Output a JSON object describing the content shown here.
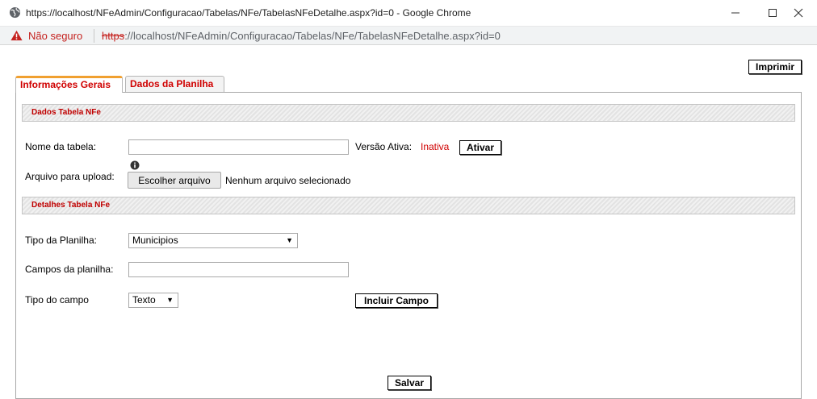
{
  "window": {
    "title": "https://localhost/NFeAdmin/Configuracao/Tabelas/NFe/TabelasNFeDetalhe.aspx?id=0 - Google Chrome",
    "icon": "globe-icon",
    "controls": [
      "minimize-icon",
      "maximize-icon",
      "close-icon"
    ]
  },
  "address_bar": {
    "security_label": "Não seguro",
    "url_scheme": "https",
    "url_rest": "://localhost/NFeAdmin/Configuracao/Tabelas/NFe/TabelasNFeDetalhe.aspx?id=0"
  },
  "toolbar": {
    "print_label": "Imprimir"
  },
  "tabs": [
    {
      "label": "Informações Gerais",
      "active": true
    },
    {
      "label": "Dados da Planilha",
      "active": false
    }
  ],
  "section_table": {
    "title": "Dados Tabela NFe",
    "table_name_label": "Nome da tabela:",
    "table_name_value": "",
    "active_version_label": "Versão Ativa:",
    "active_version_value": "Inativa",
    "activate_label": "Ativar",
    "upload_label": "Arquivo para upload:",
    "choose_file_label": "Escolher arquivo",
    "no_file_label": "Nenhum arquivo selecionado"
  },
  "section_details": {
    "title": "Detalhes Tabela NFe",
    "sheet_type_label": "Tipo da Planilha:",
    "sheet_type_value": "Municipios",
    "sheet_fields_label": "Campos da planilha:",
    "sheet_fields_value": "",
    "field_type_label": "Tipo do campo",
    "field_type_value": "Texto",
    "include_field_label": "Incluir Campo"
  },
  "footer": {
    "save_label": "Salvar"
  },
  "colors": {
    "accent_red": "#d00000",
    "tab_active_border": "#f0a030",
    "insecure_red": "#c5221f"
  }
}
